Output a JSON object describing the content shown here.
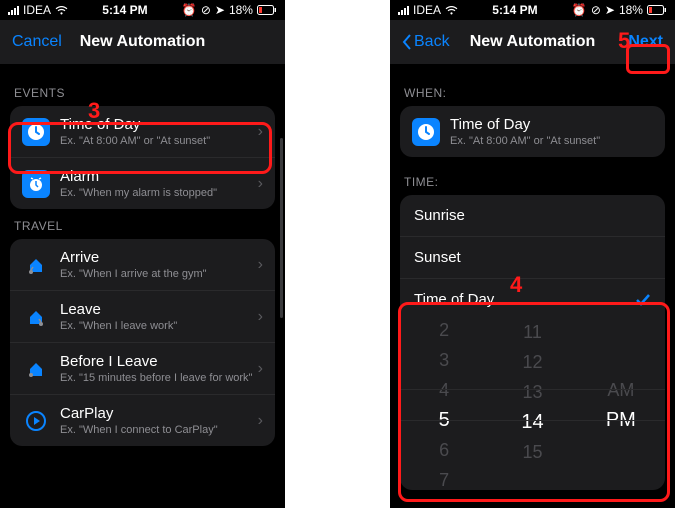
{
  "status": {
    "carrier": "IDEA",
    "time": "5:14 PM",
    "battery": "18%"
  },
  "left": {
    "nav_cancel": "Cancel",
    "nav_title": "New Automation",
    "events_label": "EVENTS",
    "time_of_day": {
      "title": "Time of Day",
      "sub": "Ex. \"At 8:00 AM\" or \"At sunset\""
    },
    "alarm": {
      "title": "Alarm",
      "sub": "Ex. \"When my alarm is stopped\""
    },
    "travel_label": "TRAVEL",
    "arrive": {
      "title": "Arrive",
      "sub": "Ex. \"When I arrive at the gym\""
    },
    "leave": {
      "title": "Leave",
      "sub": "Ex. \"When I leave work\""
    },
    "before": {
      "title": "Before I Leave",
      "sub": "Ex. \"15 minutes before I leave for work\""
    },
    "carplay": {
      "title": "CarPlay",
      "sub": "Ex. \"When I connect to CarPlay\""
    }
  },
  "right": {
    "nav_back": "Back",
    "nav_title": "New Automation",
    "nav_next": "Next",
    "when_label": "WHEN:",
    "when_card": {
      "title": "Time of Day",
      "sub": "Ex. \"At 8:00 AM\" or \"At sunset\""
    },
    "time_label": "TIME:",
    "sunrise": "Sunrise",
    "sunset": "Sunset",
    "tod": "Time of Day",
    "picker": {
      "hours": [
        "2",
        "3",
        "4",
        "5",
        "6",
        "7"
      ],
      "minutes": [
        "11",
        "12",
        "13",
        "14",
        "15",
        " "
      ],
      "ampm": [
        "",
        "",
        "AM",
        "PM",
        "",
        ""
      ]
    }
  },
  "ann": {
    "n3": "3",
    "n4": "4",
    "n5": "5"
  }
}
